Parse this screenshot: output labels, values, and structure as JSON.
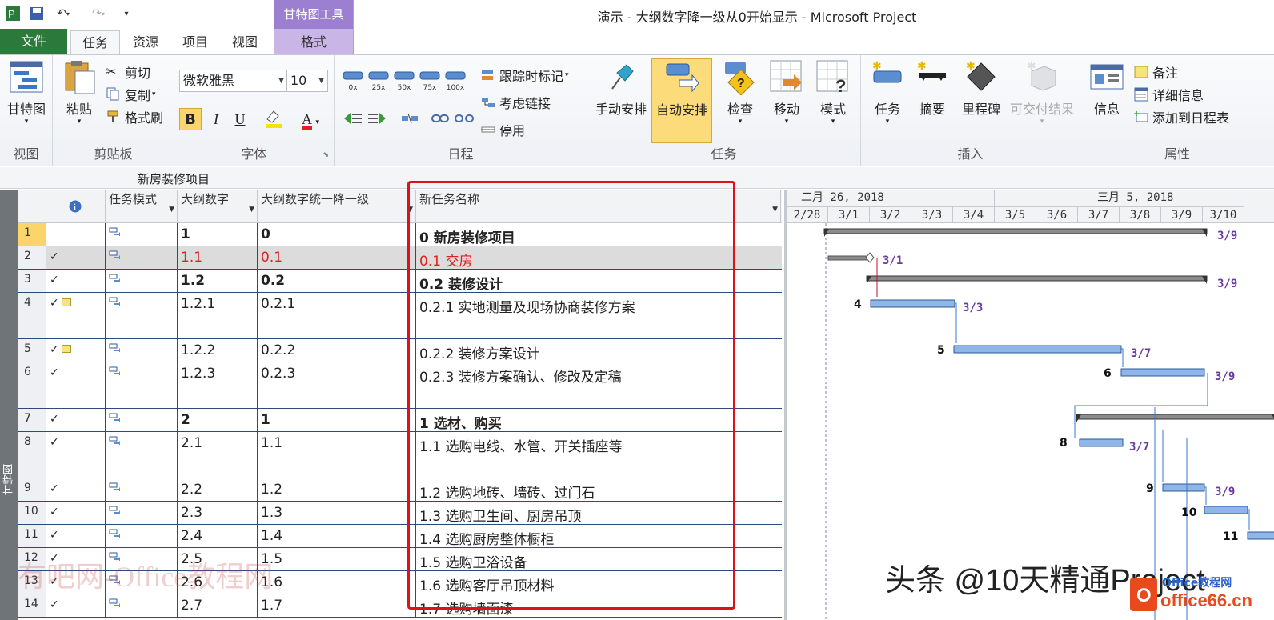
{
  "window": {
    "title": "演示 - 大纲数字降一级从0开始显示 - Microsoft Project",
    "context_tab_title": "甘特图工具"
  },
  "tabs": [
    "文件",
    "任务",
    "资源",
    "项目",
    "视图",
    "格式"
  ],
  "ribbon": {
    "view": {
      "label": "视图",
      "gantt": "甘特图"
    },
    "clipboard": {
      "label": "剪贴板",
      "paste": "粘贴",
      "cut": "剪切",
      "copy": "复制",
      "format_painter": "格式刷"
    },
    "font": {
      "label": "字体",
      "family": "微软雅黑",
      "size": "10",
      "bold": "B",
      "italic": "I",
      "underline": "U"
    },
    "schedule": {
      "label": "日程",
      "pct": [
        "0x",
        "25x",
        "50x",
        "75x",
        "100x"
      ],
      "mark_on_track": "跟踪时标记",
      "respect_links": "考虑链接",
      "inactivate": "停用"
    },
    "tasks": {
      "label": "任务",
      "manual": "手动安排",
      "auto": "自动安排",
      "inspect": "检查",
      "move": "移动",
      "mode": "模式"
    },
    "insert": {
      "label": "插入",
      "task": "任务",
      "summary": "摘要",
      "milestone": "里程碑",
      "deliverable": "可交付结果"
    },
    "properties": {
      "label": "属性",
      "information": "信息",
      "notes": "备注",
      "details": "详细信息",
      "add_timeline": "添加到日程表"
    }
  },
  "timeline": {
    "project": "新房装修项目"
  },
  "view_strip": "甘特图",
  "grid": {
    "headers": {
      "mode": "任务模式",
      "outline": "大纲数字",
      "outline_down": "大纲数字统一降一级",
      "name": "新任务名称"
    },
    "rows": [
      {
        "id": "1",
        "check": "",
        "outline": "1",
        "down": "0",
        "name": "0 新房装修项目",
        "bold": true
      },
      {
        "id": "2",
        "check": "✓",
        "outline": "1.1",
        "down": "0.1",
        "name": "0.1 交房",
        "red": true
      },
      {
        "id": "3",
        "check": "✓",
        "outline": "1.2",
        "down": "0.2",
        "name": "0.2 装修设计",
        "bold": true
      },
      {
        "id": "4",
        "check": "✓",
        "outline": "1.2.1",
        "down": "0.2.1",
        "name": "0.2.1 实地测量及现场协商装修方案",
        "note": true
      },
      {
        "id": "5",
        "check": "✓",
        "outline": "1.2.2",
        "down": "0.2.2",
        "name": "0.2.2 装修方案设计",
        "note": true
      },
      {
        "id": "6",
        "check": "✓",
        "outline": "1.2.3",
        "down": "0.2.3",
        "name": "0.2.3 装修方案确认、修改及定稿"
      },
      {
        "id": "7",
        "check": "✓",
        "outline": "2",
        "down": "1",
        "name": "1 选材、购买",
        "bold": true
      },
      {
        "id": "8",
        "check": "✓",
        "outline": "2.1",
        "down": "1.1",
        "name": "1.1 选购电线、水管、开关插座等"
      },
      {
        "id": "9",
        "check": "✓",
        "outline": "2.2",
        "down": "1.2",
        "name": "1.2 选购地砖、墙砖、过门石"
      },
      {
        "id": "10",
        "check": "✓",
        "outline": "2.3",
        "down": "1.3",
        "name": "1.3 选购卫生间、厨房吊顶"
      },
      {
        "id": "11",
        "check": "✓",
        "outline": "2.4",
        "down": "1.4",
        "name": "1.4 选购厨房整体橱柜"
      },
      {
        "id": "12",
        "check": "✓",
        "outline": "2.5",
        "down": "1.5",
        "name": "1.5 选购卫浴设备"
      },
      {
        "id": "13",
        "check": "✓",
        "outline": "2.6",
        "down": "1.6",
        "name": "1.6 选购客厅吊顶材料"
      },
      {
        "id": "14",
        "check": "✓",
        "outline": "2.7",
        "down": "1.7",
        "name": "1.7 选购墙面漆"
      }
    ]
  },
  "gantt": {
    "weeks": [
      "二月 26, 2018",
      "三月 5, 2018"
    ],
    "days": [
      "2/28",
      "3/1",
      "3/2",
      "3/3",
      "3/4",
      "3/5",
      "3/6",
      "3/7",
      "3/8",
      "3/9",
      "3/10"
    ],
    "bar_labels": [
      "3/9",
      "3/1",
      "3/9",
      "3/3",
      "3/7",
      "3/9",
      "3/7",
      "3/9"
    ],
    "task_ids": [
      "4",
      "5",
      "6",
      "8",
      "9",
      "10",
      "11"
    ]
  },
  "watermarks": {
    "left": "有吧网-Office教程网",
    "right": "头条 @10天精通Project",
    "logo_text": "Office教程网",
    "logo_url": "office66.cn"
  }
}
